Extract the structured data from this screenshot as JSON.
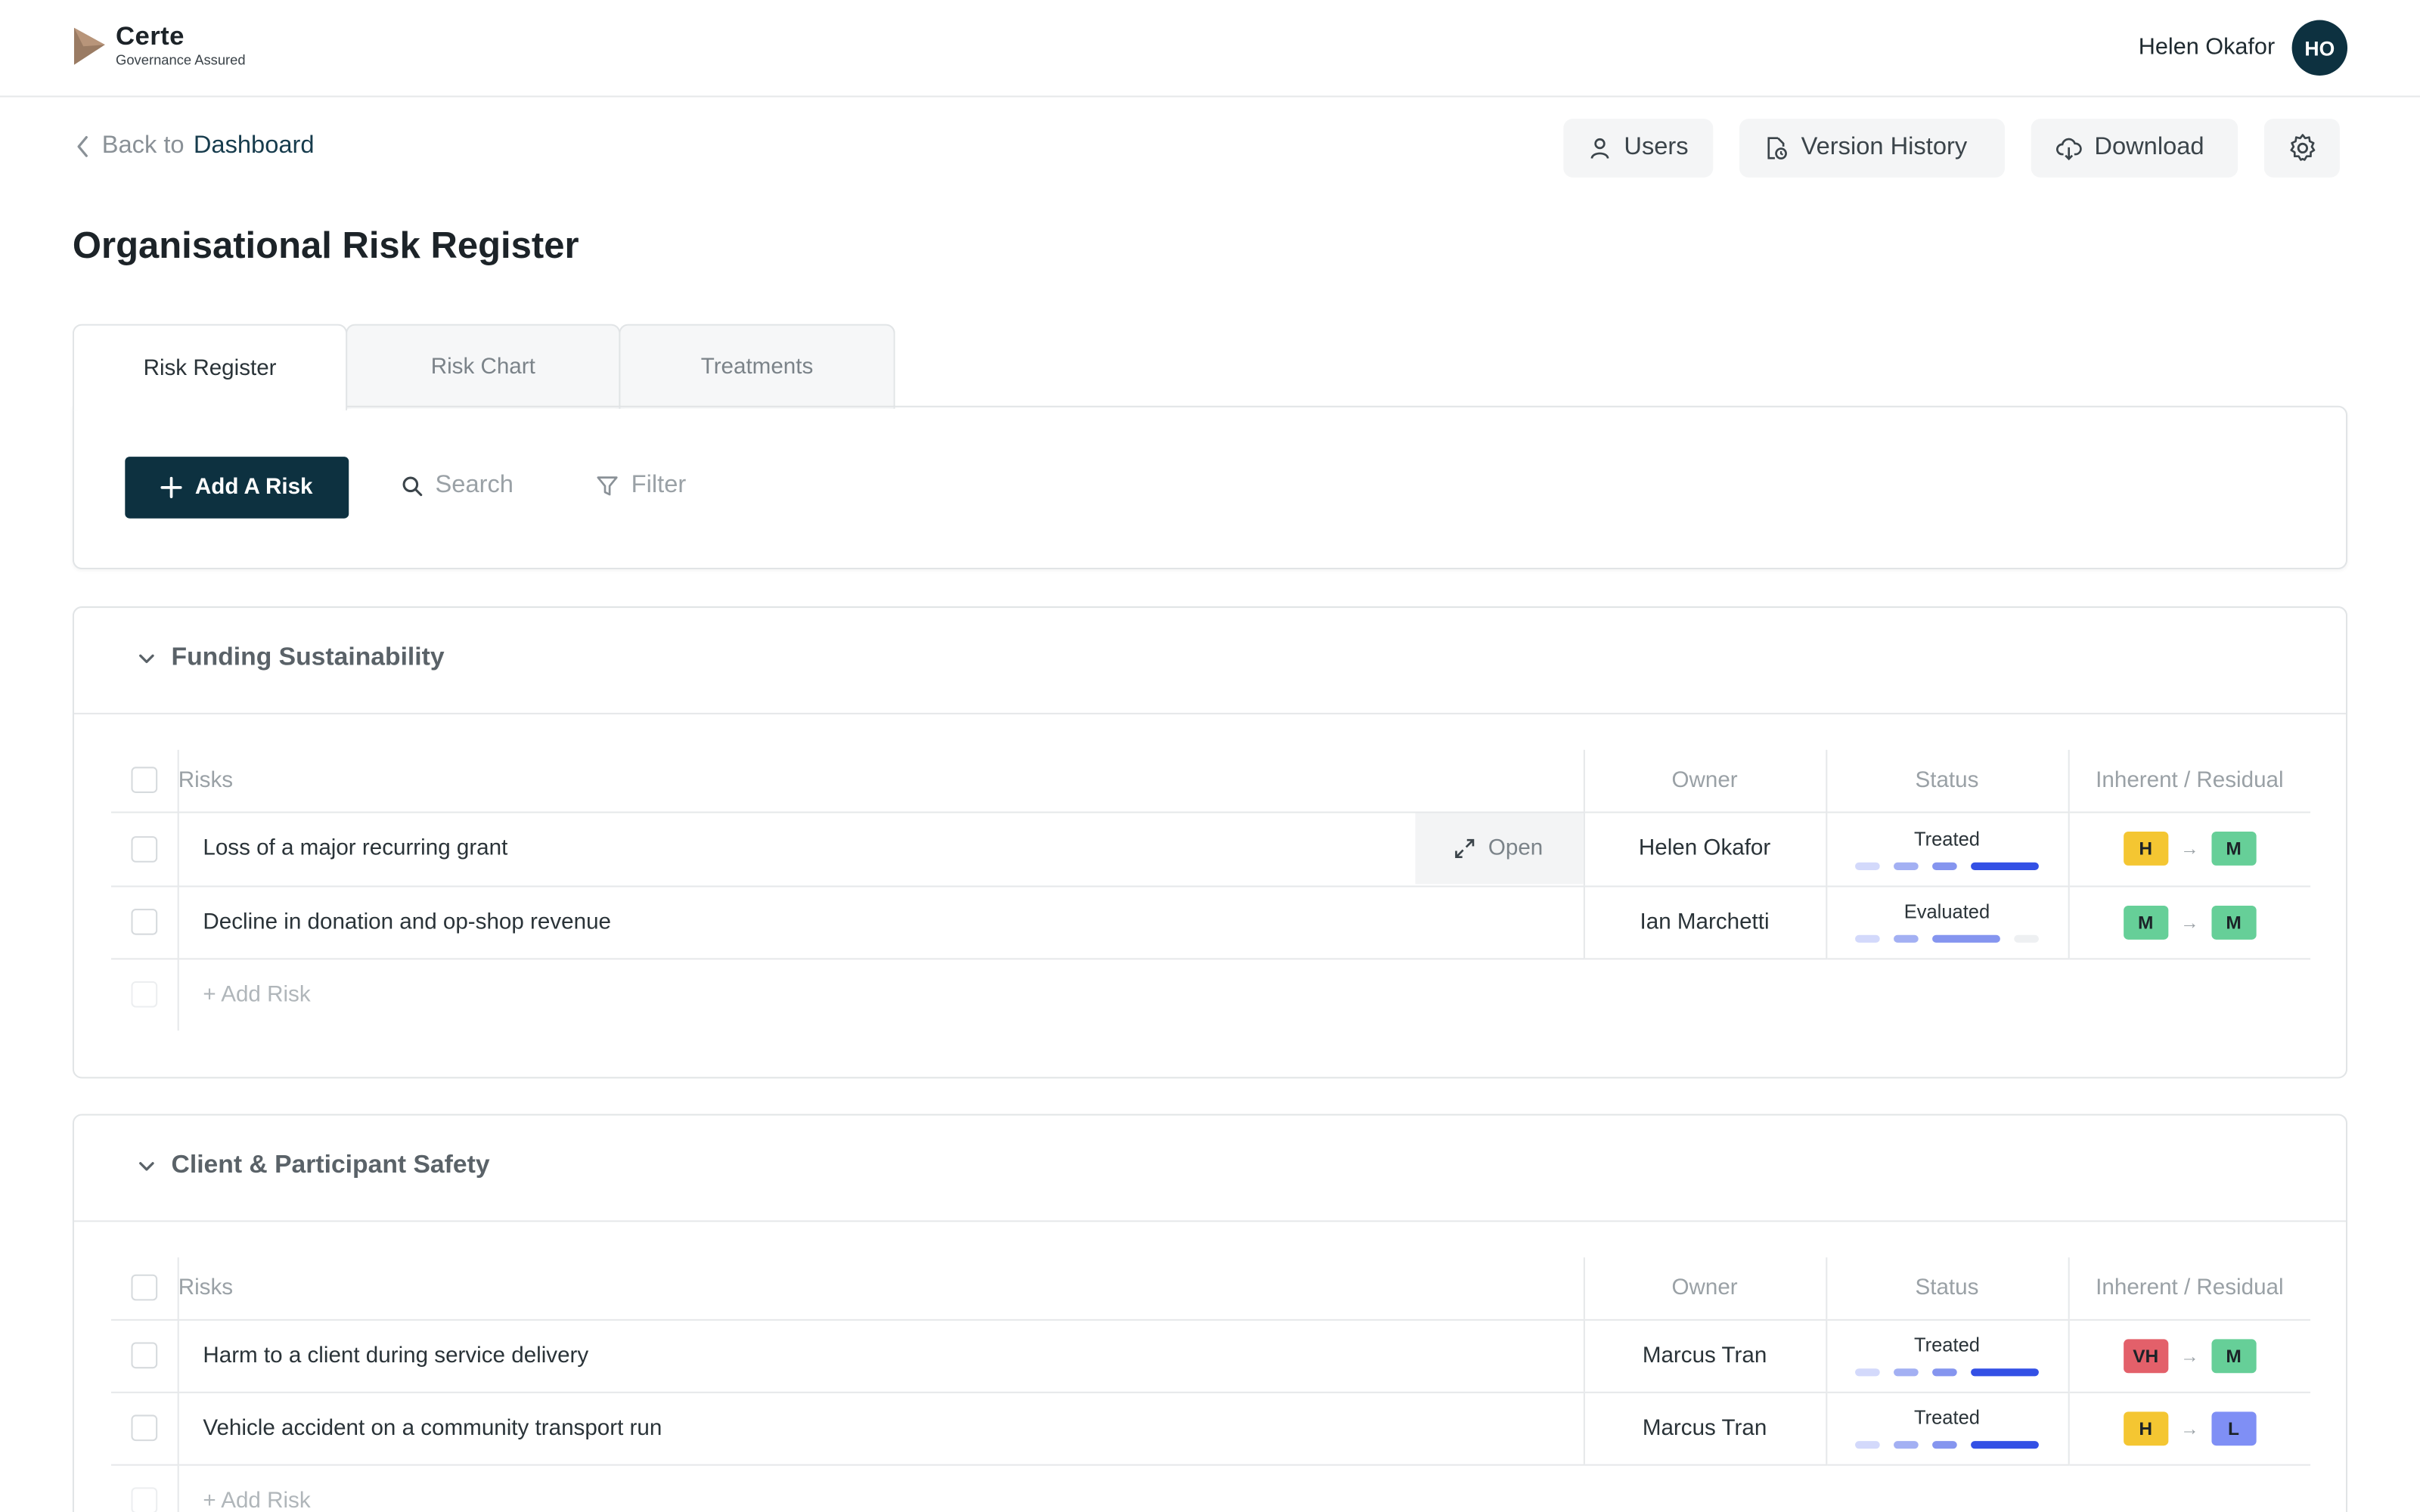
{
  "header": {
    "brand_name": "Certe",
    "brand_tagline": "Governance Assured",
    "user_name": "Helen Okafor",
    "user_initials": "HO"
  },
  "subheader": {
    "back_prefix": "Back to",
    "back_link": "Dashboard",
    "users_label": "Users",
    "version_history_label": "Version History",
    "download_label": "Download"
  },
  "page_title": "Organisational Risk Register",
  "tabs": [
    {
      "label": "Risk Register",
      "active": true
    },
    {
      "label": "Risk Chart",
      "active": false
    },
    {
      "label": "Treatments",
      "active": false
    }
  ],
  "toolbar": {
    "add_risk_label": "Add A Risk",
    "search_placeholder": "Search",
    "filter_label": "Filter"
  },
  "columns": {
    "risks": "Risks",
    "owner": "Owner",
    "status": "Status",
    "inherent_residual": "Inherent / Residual"
  },
  "colors": {
    "brand_dark": "#0d3140",
    "level_VH": "#e3606a",
    "level_H": "#f4c632",
    "level_M": "#66cf98",
    "level_L": "#7f8ff5",
    "bar_light": "#d3d9fb",
    "bar_mid": "#a3b0f3",
    "bar_strong": "#8595ef",
    "bar_done": "#3350e5",
    "bar_empty": "#eef0f2"
  },
  "groups": [
    {
      "title": "Funding Sustainability",
      "rows": [
        {
          "risk": "Loss of a major recurring grant",
          "owner": "Helen Okafor",
          "status": "Treated",
          "status_step": 4,
          "inherent": "H",
          "residual": "M",
          "open_label": "Open"
        },
        {
          "risk": "Decline in donation and op-shop revenue",
          "owner": "Ian Marchetti",
          "status": "Evaluated",
          "status_step": 3,
          "inherent": "M",
          "residual": "M"
        }
      ],
      "add_row_label": "+ Add Risk"
    },
    {
      "title": "Client & Participant Safety",
      "rows": [
        {
          "risk": "Harm to a client during service delivery",
          "owner": "Marcus Tran",
          "status": "Treated",
          "status_step": 4,
          "inherent": "VH",
          "residual": "M"
        },
        {
          "risk": "Vehicle accident on a community transport run",
          "owner": "Marcus Tran",
          "status": "Treated",
          "status_step": 4,
          "inherent": "H",
          "residual": "L"
        }
      ],
      "add_row_label": "+ Add Risk"
    }
  ]
}
